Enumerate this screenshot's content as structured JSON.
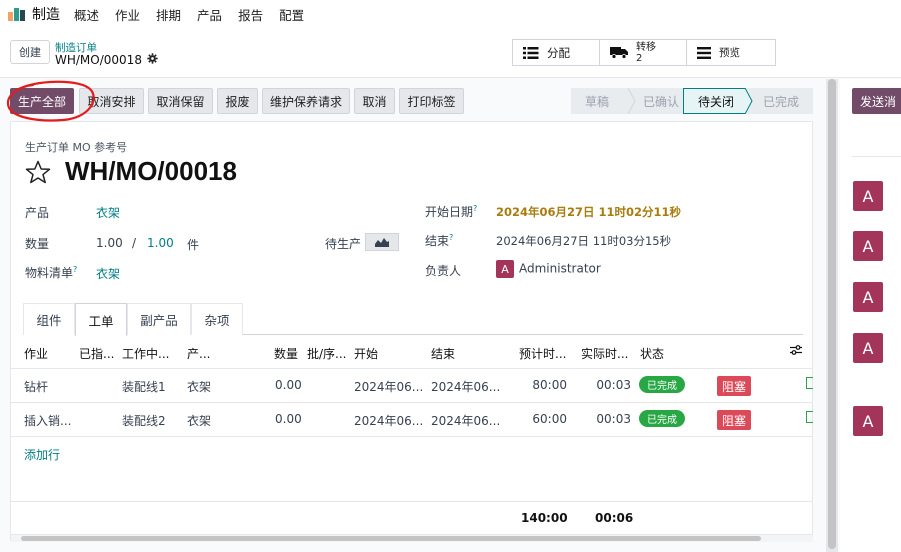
{
  "nav": {
    "app_name": "制造",
    "items": [
      "概述",
      "作业",
      "排期",
      "产品",
      "报告",
      "配置"
    ],
    "logo_colors": [
      "#f4a261",
      "#2a9d8f",
      "#264653"
    ]
  },
  "control": {
    "create_label": "创建",
    "breadcrumb_parent": "制造订单",
    "breadcrumb_current": "WH/MO/00018",
    "smart_buttons": {
      "allocate": "分配",
      "transfer_label": "转移",
      "transfer_count": "2",
      "preview": "预览"
    }
  },
  "actions": {
    "produce_all": "生产全部",
    "unplan": "取消安排",
    "unreserve": "取消保留",
    "scrap": "报废",
    "maintenance": "维护保养请求",
    "cancel": "取消",
    "print_labels": "打印标签"
  },
  "stages": {
    "items": [
      "草稿",
      "已确认",
      "待关闭",
      "已完成"
    ],
    "active_index": 2
  },
  "form": {
    "ref_label": "生产订单 MO 参考号",
    "ref": "WH/MO/00018",
    "product_label": "产品",
    "product_value": "衣架",
    "quantity_label": "数量",
    "quantity_produced": "1.00",
    "quantity_sep": "/",
    "quantity_total": "1.00",
    "quantity_uom": "件",
    "to_produce_label": "待生产",
    "bom_label": "物料清单",
    "bom_value": "衣架",
    "start_label": "开始日期",
    "start_value": "2024年06月27日 11时02分11秒",
    "end_label": "结束",
    "end_value": "2024年06月27日 11时03分15秒",
    "responsible_label": "负责人",
    "responsible_avatar": "A",
    "responsible_value": "Administrator",
    "help_mark": "?"
  },
  "tabs": [
    "组件",
    "工单",
    "副产品",
    "杂项"
  ],
  "workorders": {
    "headers": [
      "作业",
      "已指...",
      "工作中...",
      "产...",
      "数量",
      "批/序...",
      "开始",
      "结束",
      "预计时...",
      "实际时...",
      "状态"
    ],
    "rows": [
      {
        "operation": "钻杆",
        "workcenter": "装配线1",
        "product": "衣架",
        "qty": "0.00",
        "start": "2024年06...",
        "end": "2024年06...",
        "expected": "80:00",
        "real": "00:03",
        "status": "已完成",
        "block": "阻塞"
      },
      {
        "operation": "插入销...",
        "workcenter": "装配线2",
        "product": "衣架",
        "qty": "0.00",
        "start": "2024年06...",
        "end": "2024年06...",
        "expected": "60:00",
        "real": "00:03",
        "status": "已完成",
        "block": "阻塞"
      }
    ],
    "add_line": "添加行",
    "total_expected": "140:00",
    "total_real": "00:06"
  },
  "chatter": {
    "send_label": "发送消",
    "avatars": [
      "A",
      "A",
      "A",
      "A",
      "A"
    ]
  },
  "colors": {
    "brand": "#714b67",
    "teal": "#017e84",
    "done_green": "#28a745",
    "block_red": "#dc4a5a",
    "avatar": "#a3355a",
    "annotation": "#e11d1d"
  }
}
